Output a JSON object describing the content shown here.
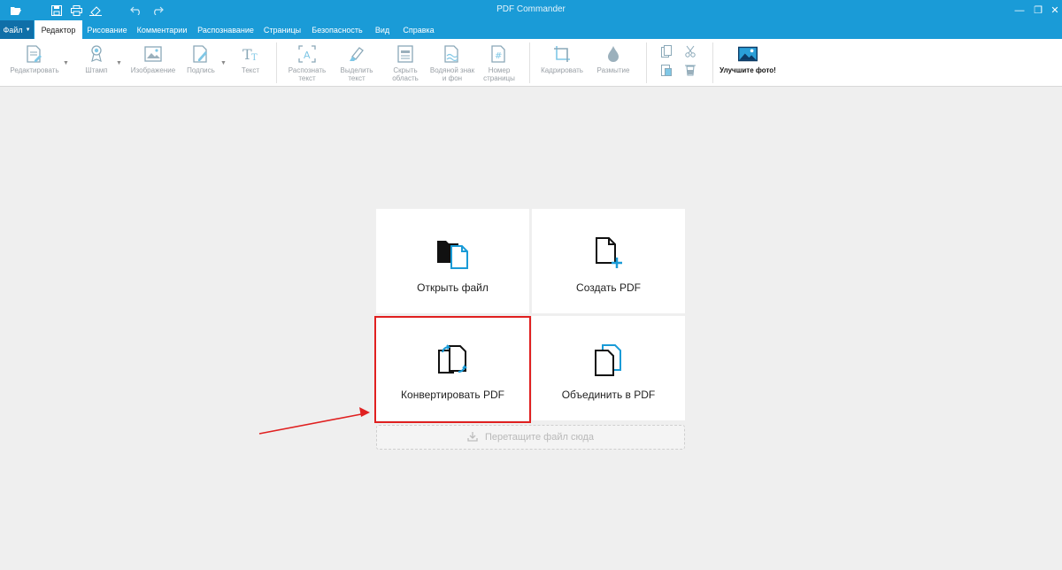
{
  "window": {
    "title": "PDF Commander",
    "controls": {
      "minimize": "—",
      "restore": "❐",
      "close": "✕"
    }
  },
  "quick_access": [
    "open-folder-icon",
    "save-icon",
    "print-icon",
    "scan-icon",
    "undo-icon",
    "redo-icon"
  ],
  "menu": {
    "file_label": "Файл",
    "tabs": [
      {
        "label": "Редактор",
        "active": true
      },
      {
        "label": "Рисование"
      },
      {
        "label": "Комментарии"
      },
      {
        "label": "Распознавание"
      },
      {
        "label": "Страницы"
      },
      {
        "label": "Безопасность"
      },
      {
        "label": "Вид"
      },
      {
        "label": "Справка"
      }
    ]
  },
  "ribbon": {
    "edit": "Редактировать",
    "stamp": "Штамп",
    "image": "Изображение",
    "signature": "Подпись",
    "text": "Текст",
    "recognize": "Распознать\nтекст",
    "select_text": "Выделить\nтекст",
    "hide_area": "Скрыть\nобласть",
    "watermark": "Водяной знак\nи фон",
    "page_number": "Номер\nстраницы",
    "crop": "Кадрировать",
    "blur": "Размытие",
    "improve_photo": "Улучшите фото!"
  },
  "start": {
    "open_file": "Открыть файл",
    "create_pdf": "Создать PDF",
    "convert_pdf": "Конвертировать PDF",
    "merge_pdf": "Объединить в PDF",
    "drop_hint": "Перетащите файл сюда"
  },
  "colors": {
    "accent": "#1a9bd7",
    "accent_dark": "#0f6fa8",
    "highlight": "#e02020"
  }
}
